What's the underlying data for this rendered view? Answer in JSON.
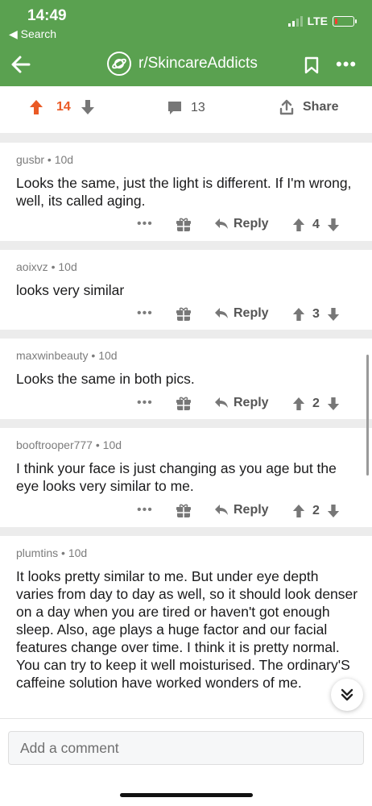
{
  "status_bar": {
    "time": "14:49",
    "back_label": "◀ Search",
    "network": "LTE",
    "battery_level": 0.15
  },
  "header": {
    "subreddit": "r/SkincareAddicts",
    "icons": [
      "back-arrow-icon",
      "planet-icon",
      "bookmark-icon",
      "more-icon"
    ],
    "accent": "#5aa150"
  },
  "post": {
    "score": "14",
    "comments": "13",
    "share_label": "Share",
    "upvote_color": "#ea5a25"
  },
  "comments": [
    {
      "author": "gusbr",
      "age": "10d",
      "body": "Looks the same, just the light is different. If I'm wrong, well, its called aging.",
      "reply_label": "Reply",
      "score": "4"
    },
    {
      "author": "aoixvz",
      "age": "10d",
      "body": "looks very similar",
      "reply_label": "Reply",
      "score": "3"
    },
    {
      "author": "maxwinbeauty",
      "age": "10d",
      "body": "Looks the same in both pics.",
      "reply_label": "Reply",
      "score": "2"
    },
    {
      "author": "booftrooper777",
      "age": "10d",
      "body": "I think your face is just changing as you age but the eye looks very similar to me.",
      "reply_label": "Reply",
      "score": "2"
    },
    {
      "author": "plumtins",
      "age": "10d",
      "body": "It looks pretty similar to me. But under eye depth varies from day to day as well, so it should look denser on a day when you are tired or haven't got enough sleep. Also, age plays a huge factor and our facial features change over time. I think it is pretty normal. You can try to keep it well moisturised. The ordinary'S caffeine solution have worked wonders of me."
    }
  ],
  "composer": {
    "placeholder": "Add a comment"
  }
}
